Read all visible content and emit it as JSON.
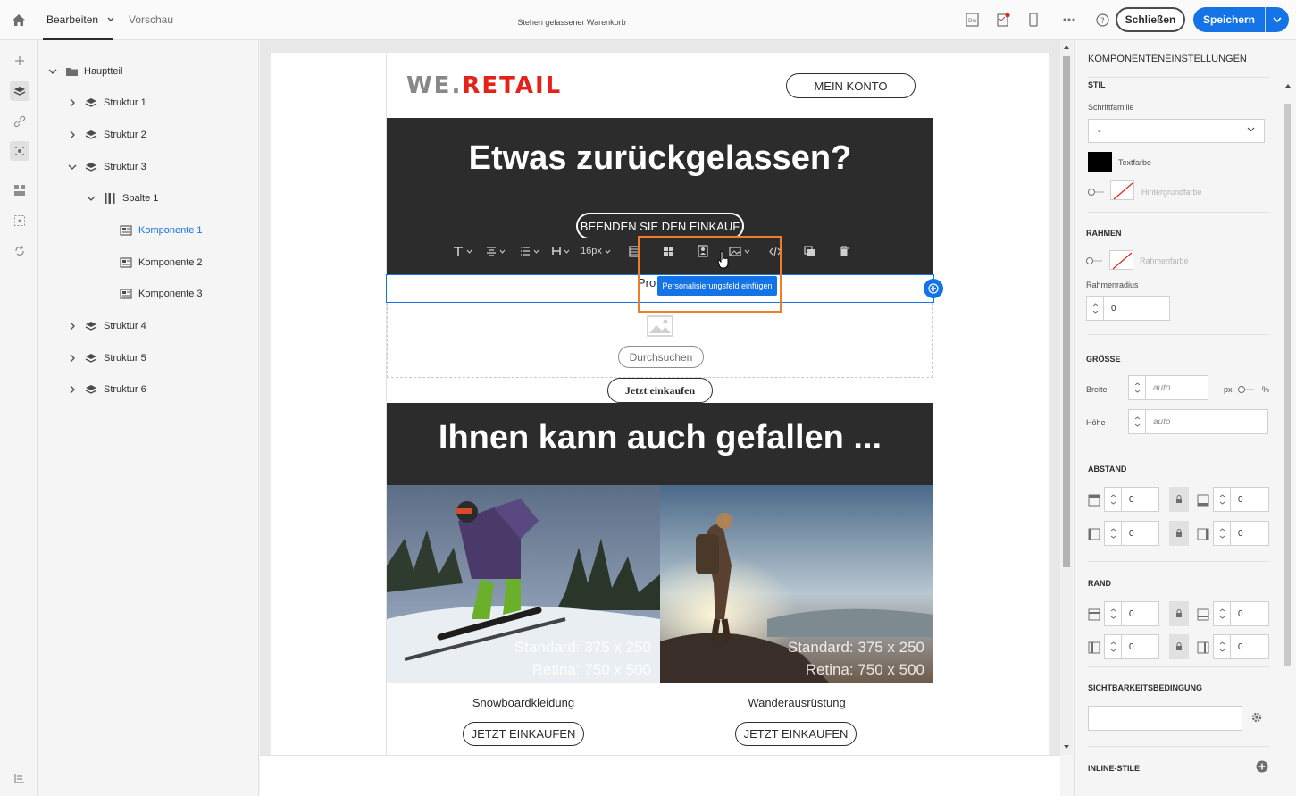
{
  "topbar": {
    "tab_edit": "Bearbeiten",
    "tab_preview": "Vorschau",
    "document_title": "Stehen gelassener Warenkorb",
    "close_label": "Schließen",
    "save_label": "Speichern",
    "accent_color": "#1473e6"
  },
  "tree": {
    "root": "Hauptteil",
    "structure1": "Struktur 1",
    "structure2": "Struktur 2",
    "structure3": "Struktur 3",
    "column1": "Spalte 1",
    "component1": "Komponente 1",
    "component2": "Komponente 2",
    "component3": "Komponente 3",
    "structure4": "Struktur 4",
    "structure5": "Struktur 5",
    "structure6": "Struktur 6"
  },
  "email": {
    "logo_part1": "WE.",
    "logo_part2": "RETAIL",
    "account_button": "MEIN KONTO",
    "hero_title": "Etwas zurückgelassen?",
    "finish_button": "BEENDEN SIE DEN EINKAUF",
    "toolbar_font_size": "16px",
    "selected_text": "Pro",
    "tooltip": "Personalisierungsfeld einfügen",
    "browse_button": "Durchsuchen",
    "shop_now_button": "Jetzt einkaufen",
    "section2_title": "Ihnen kann auch gefallen ...",
    "products": [
      {
        "caption1": "Standard: 375 x 250",
        "caption2": "Retina: 750 x 500",
        "label": "Snowboardkleidung",
        "button": "JETZT EINKAUFEN"
      },
      {
        "caption1": "Standard: 375 x 250",
        "caption2": "Retina: 750 x 500",
        "label": "Wanderausrüstung",
        "button": "JETZT EINKAUFEN"
      }
    ],
    "highlight_color": "#f07c2c"
  },
  "settings": {
    "title": "KOMPONENTENEINSTELLUNGEN",
    "style_section": "STIL",
    "font_family_label": "Schriftfamilie",
    "font_family_value": "-",
    "text_color_label": "Textfarbe",
    "text_color": "#000000",
    "bg_color_label": "Hintergrundfarbe",
    "border_section": "RAHMEN",
    "border_color_label": "Rahmenfarbe",
    "border_radius_label": "Rahmenradius",
    "border_radius_value": "0",
    "size_section": "GRÖSSE",
    "width_label": "Breite",
    "width_value": "auto",
    "unit_px": "px",
    "unit_pct": "%",
    "height_label": "Höhe",
    "height_value": "auto",
    "spacing_section": "ABSTAND",
    "spacing_values": [
      "0",
      "0",
      "0",
      "0"
    ],
    "margin_section": "RAND",
    "margin_values": [
      "0",
      "0",
      "0",
      "0"
    ],
    "visibility_section": "SICHTBARKEITSBEDINGUNG",
    "inline_styles_section": "INLINE-STILE"
  }
}
